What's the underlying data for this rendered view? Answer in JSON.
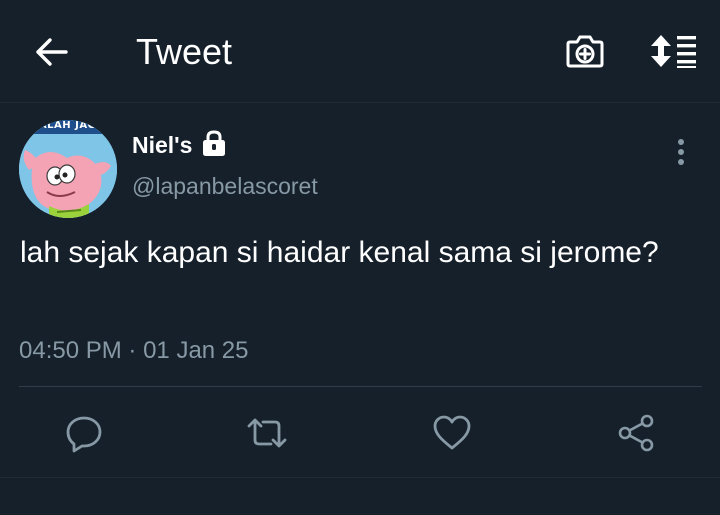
{
  "header": {
    "title": "Tweet",
    "back_icon": "arrow-left-icon",
    "camera_icon": "camera-plus-icon",
    "sort_icon": "sort-list-icon"
  },
  "tweet": {
    "author_name": "Niel's",
    "protected_icon": "lock-icon",
    "handle": "@lapanbelascoret",
    "avatar_caption": "KALAH JAGO",
    "text": "lah sejak kapan si haidar kenal sama si jerome?",
    "time": "04:50 PM",
    "separator": "·",
    "date": "01 Jan 25",
    "more_icon": "more-vertical-icon"
  },
  "actions": [
    {
      "name": "reply",
      "icon": "reply-icon"
    },
    {
      "name": "retweet",
      "icon": "retweet-icon"
    },
    {
      "name": "like",
      "icon": "heart-icon"
    },
    {
      "name": "share",
      "icon": "share-icon"
    }
  ],
  "colors": {
    "background": "#15202b",
    "primary_text": "#ffffff",
    "secondary_text": "#8899a6",
    "icon": "#8899a6",
    "divider": "#2f3d4b"
  }
}
